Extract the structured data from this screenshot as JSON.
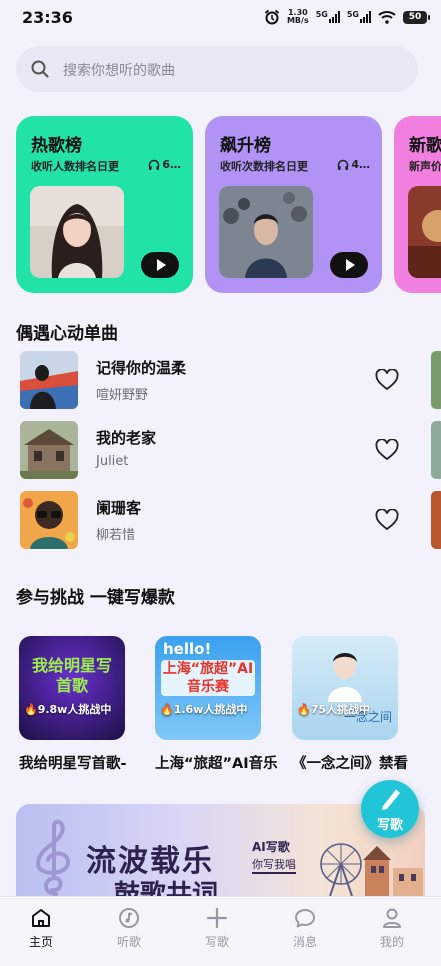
{
  "status_bar": {
    "time": "23:36",
    "net_speed": "1.30",
    "net_unit": "MB/s",
    "signal1": "5G",
    "signal2": "5G",
    "battery": "50"
  },
  "search": {
    "placeholder": "搜索你想听的歌曲"
  },
  "charts": [
    {
      "title": "热歌榜",
      "subtitle": "收听人数排名日更",
      "plays": "6…",
      "color": "#21e3a8"
    },
    {
      "title": "飙升榜",
      "subtitle": "收听次数排名日更",
      "plays": "4…",
      "color": "#b192f5"
    },
    {
      "title": "新歌",
      "subtitle": "新声价",
      "color": "#f07fe0"
    }
  ],
  "songs_section": {
    "title": "偶遇心动单曲",
    "songs": [
      {
        "name": "记得你的温柔",
        "artist": "喧妍野野"
      },
      {
        "name": "我的老家",
        "artist": "Juliet"
      },
      {
        "name": "阑珊客",
        "artist": "柳若惜"
      }
    ]
  },
  "challenge_section": {
    "title": "参与挑战 一键写爆款",
    "items": [
      {
        "badge": "🔥9.8w人挑战中",
        "label": "我给明星写首歌-",
        "art": "我给明星写首歌"
      },
      {
        "badge": "🔥1.6w人挑战中",
        "label": "上海“旅超”AI音乐",
        "art_top": "hello!",
        "art": "上海“旅超”AI音乐赛"
      },
      {
        "badge": "🔥75人挑战中",
        "label": "《一念之间》禁看",
        "art": "一念之间"
      }
    ]
  },
  "banner": {
    "line1": "流波载乐",
    "line2": "鼓歌共词",
    "tag1": "AI写歌",
    "tag2": "你写我唱"
  },
  "fab": {
    "label": "写歌"
  },
  "bottom_nav": {
    "items": [
      {
        "label": "主页",
        "icon": "home-icon",
        "active": true
      },
      {
        "label": "听歌",
        "icon": "music-disc-icon"
      },
      {
        "label": "写歌",
        "icon": "plus-icon"
      },
      {
        "label": "消息",
        "icon": "chat-bubble-icon"
      },
      {
        "label": "我的",
        "icon": "person-icon"
      }
    ]
  }
}
